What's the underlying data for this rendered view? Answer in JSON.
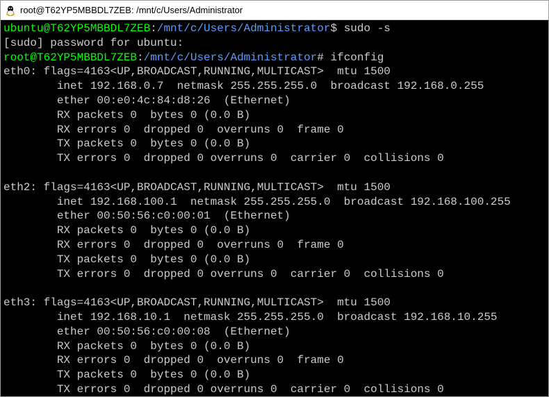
{
  "title": "root@T62YP5MBBDL7ZEB: /mnt/c/Users/Administrator",
  "prompt1": {
    "userhost": "ubuntu@T62YP5MBBDL7ZEB",
    "sep": ":",
    "path": "/mnt/c/Users/Administrator",
    "dollar": "$",
    "cmd": " sudo -s"
  },
  "sudo_line": "[sudo] password for ubuntu:",
  "prompt2": {
    "userhost": "root@T62YP5MBBDL7ZEB",
    "sep": ":",
    "path": "/mnt/c/Users/Administrator",
    "hash": "#",
    "cmd": " ifconfig"
  },
  "eth0": {
    "l1": "eth0: flags=4163<UP,BROADCAST,RUNNING,MULTICAST>  mtu 1500",
    "l2": "        inet 192.168.0.7  netmask 255.255.255.0  broadcast 192.168.0.255",
    "l3": "        ether 00:e0:4c:84:d8:26  (Ethernet)",
    "l4": "        RX packets 0  bytes 0 (0.0 B)",
    "l5": "        RX errors 0  dropped 0  overruns 0  frame 0",
    "l6": "        TX packets 0  bytes 0 (0.0 B)",
    "l7": "        TX errors 0  dropped 0 overruns 0  carrier 0  collisions 0"
  },
  "eth2": {
    "l1": "eth2: flags=4163<UP,BROADCAST,RUNNING,MULTICAST>  mtu 1500",
    "l2": "        inet 192.168.100.1  netmask 255.255.255.0  broadcast 192.168.100.255",
    "l3": "        ether 00:50:56:c0:00:01  (Ethernet)",
    "l4": "        RX packets 0  bytes 0 (0.0 B)",
    "l5": "        RX errors 0  dropped 0  overruns 0  frame 0",
    "l6": "        TX packets 0  bytes 0 (0.0 B)",
    "l7": "        TX errors 0  dropped 0 overruns 0  carrier 0  collisions 0"
  },
  "eth3": {
    "l1": "eth3: flags=4163<UP,BROADCAST,RUNNING,MULTICAST>  mtu 1500",
    "l2": "        inet 192.168.10.1  netmask 255.255.255.0  broadcast 192.168.10.255",
    "l3": "        ether 00:50:56:c0:00:08  (Ethernet)",
    "l4": "        RX packets 0  bytes 0 (0.0 B)",
    "l5": "        RX errors 0  dropped 0  overruns 0  frame 0",
    "l6": "        TX packets 0  bytes 0 (0.0 B)",
    "l7": "        TX errors 0  dropped 0 overruns 0  carrier 0  collisions 0"
  }
}
